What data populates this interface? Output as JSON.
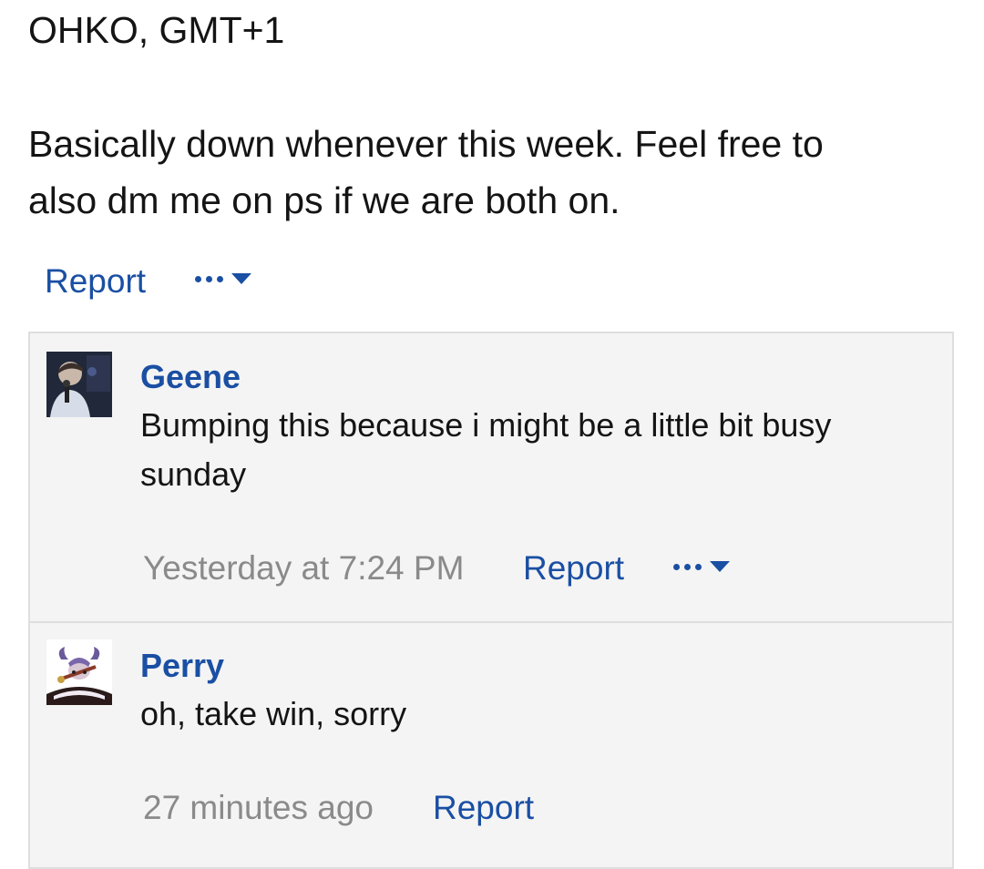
{
  "post": {
    "line1": "OHKO, GMT+1",
    "line2": "Basically down whenever this week. Feel free to",
    "line3": "also dm me on ps if we are both on.",
    "report_label": "Report"
  },
  "replies": [
    {
      "author": "Geene",
      "text_line1": "Bumping this because i might be a little bit busy",
      "text_line2": "sunday",
      "time": "Yesterday at 7:24 PM",
      "report_label": "Report"
    },
    {
      "author": "Perry",
      "text_line1": "oh, take win, sorry",
      "time": "27 minutes ago",
      "report_label": "Report"
    }
  ],
  "icons": {
    "more": "ellipsis-icon",
    "dropdown": "caret-down-icon"
  },
  "colors": {
    "link": "#1a4fa3",
    "muted": "#8a8a8a",
    "panel_bg": "#f4f4f4",
    "border": "#dedede"
  }
}
